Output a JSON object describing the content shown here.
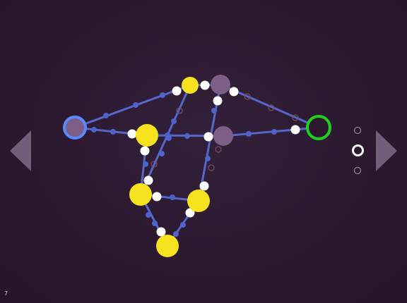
{
  "level": {
    "number": "7"
  },
  "page_indicator": {
    "count": 3,
    "active_index": 1
  },
  "colors": {
    "background": "#2c1930",
    "edge": "#5567c8",
    "edge_dot": "#4f63cc",
    "waypoint": "#ffffff",
    "sun_node": "#f6e21e",
    "inactive_node": "#7d5e86",
    "start_ring": "#5c88ff",
    "goal_ring": "#1fd11f",
    "arrow": "#6f5f7a",
    "hollow_marker": "#7a4a60"
  },
  "icons": {
    "prev": "triangle-left",
    "next": "triangle-right",
    "page_dot": "ring"
  }
}
